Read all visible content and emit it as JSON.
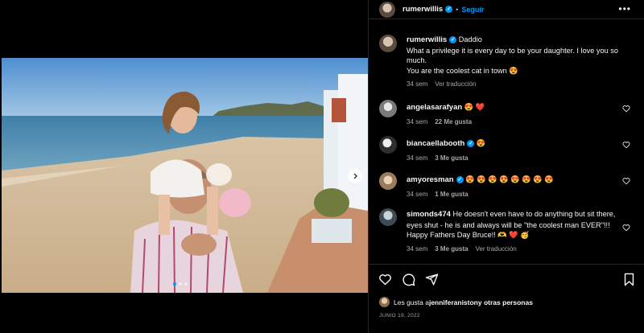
{
  "post": {
    "author": "rumerwillis",
    "follow_sep": "•",
    "follow_label": "Seguir",
    "more_icon": "more-horizontal-icon",
    "carousel": {
      "slides": 3,
      "active_slide": 1
    }
  },
  "caption": {
    "username": "rumerwillis",
    "text_1": "Daddio",
    "text_2": "What a privilege it is every day to be your daughter. I love you so much.",
    "text_3": "You are the coolest cat in town 😍",
    "time": "34 sem",
    "translate": "Ver traducción"
  },
  "comments": [
    {
      "username": "angelasarafyan",
      "text": "😍 ❤️",
      "time": "34 sem",
      "likes": "22 Me gusta",
      "verified": true
    },
    {
      "username": "biancaellabooth",
      "text": "😍",
      "time": "34 sem",
      "likes": "3 Me gusta",
      "verified": true
    },
    {
      "username": "amyoresman",
      "text": "😍 😍 😍 😍 😍 😍 😍 😍",
      "time": "34 sem",
      "likes": "1 Me gusta",
      "verified": true
    },
    {
      "username": "simonds474",
      "text": "He doesn't even have to do anything but sit there, eyes shut - he is and always will be \"the coolest man EVER\"!!! Happy Fathers Day Bruce!! 🫶 ❤️ 🥳",
      "time": "34 sem",
      "likes": "3 Me gusta",
      "translate": "Ver traducción",
      "verified": false
    }
  ],
  "likes_line": {
    "prefix": "Les gusta a ",
    "name": "jenniferaniston",
    "suffix": " y otras personas"
  },
  "date": "JUNIO 19, 2022",
  "colors": {
    "accent": "#0095f6",
    "heart": "#ed4956",
    "muted": "#a8a8a8",
    "background": "#000000"
  }
}
